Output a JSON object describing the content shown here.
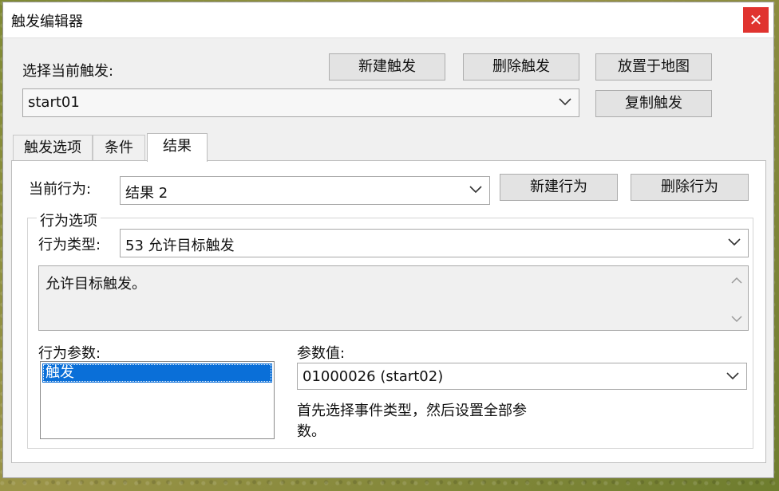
{
  "window": {
    "title": "触发编辑器",
    "close_glyph": "✕"
  },
  "trigger": {
    "select_label": "选择当前触发:",
    "current": "start01",
    "new_button": "新建触发",
    "delete_button": "删除触发",
    "place_button": "放置于地图",
    "copy_button": "复制触发"
  },
  "tabs": [
    {
      "label": "触发选项"
    },
    {
      "label": "条件"
    },
    {
      "label": "结果",
      "active": true
    }
  ],
  "result": {
    "current_label": "当前行为:",
    "current_value": "结果 2",
    "new_action_button": "新建行为",
    "delete_action_button": "删除行为"
  },
  "action_options": {
    "group_title": "行为选项",
    "type_label": "行为类型:",
    "type_value": "53 允许目标触发",
    "description": "允许目标触发。"
  },
  "params": {
    "list_label": "行为参数:",
    "items": [
      "触发"
    ],
    "value_label": "参数值:",
    "value": "01000026 (start02)",
    "hint": "首先选择事件类型，然后设置全部参数。"
  },
  "colors": {
    "close": "#e0332f",
    "selection": "#0a6fd8"
  }
}
